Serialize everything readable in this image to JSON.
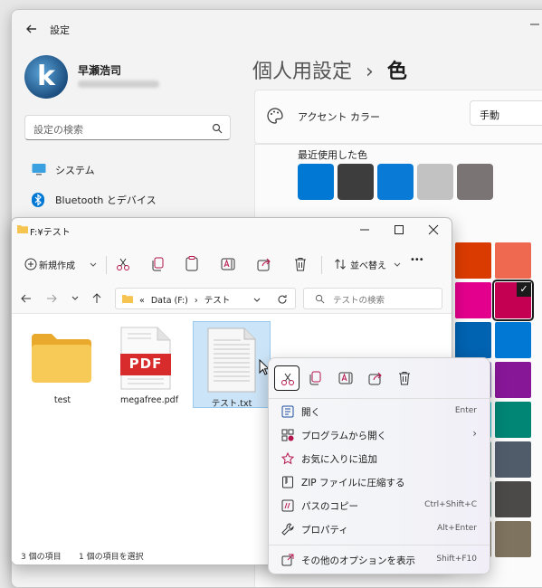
{
  "settings": {
    "app_title": "設定",
    "user_name": "早瀬浩司",
    "avatar_letter": "k",
    "search_placeholder": "設定の検索",
    "nav": [
      {
        "label": "システム",
        "icon": "monitor-icon"
      },
      {
        "label": "Bluetooth とデバイス",
        "icon": "bluetooth-icon"
      }
    ],
    "breadcrumb_parent": "個人用設定",
    "breadcrumb_sep": "›",
    "breadcrumb_current": "色",
    "accent_label": "アクセント カラー",
    "accent_mode": "手動",
    "recent_colors_label": "最近使用した色",
    "recent_colors": [
      "#0078d4",
      "#3d3d3d",
      "#0a7ad7",
      "#c2c2c2",
      "#7a7574"
    ],
    "palette_colors": [
      [
        "#da3b01",
        "#ef6950"
      ],
      [
        "#e3008c",
        "#c30052"
      ],
      [
        "#0063b1",
        "#0078d4"
      ],
      [
        "#8764b8",
        "#881798"
      ],
      [
        "#00b7c3",
        "#018574"
      ],
      [
        "#567c73",
        "#515c6b"
      ],
      [
        "#567c73",
        "#4c4a48"
      ],
      [
        "#7e735f",
        "#7e735f"
      ]
    ],
    "selected_check": "✓"
  },
  "explorer": {
    "title": "F:¥テスト",
    "new_label": "新規作成",
    "sort_label": "並べ替え",
    "more_label": "•••",
    "address_parent": "Data (F:)",
    "address_sep": "›",
    "address_current": "テスト",
    "address_prefix": "«",
    "search_placeholder": "テストの検索",
    "files": [
      {
        "name": "test",
        "type": "folder"
      },
      {
        "name": "megafree.pdf",
        "type": "pdf",
        "badge": "PDF"
      },
      {
        "name": "テスト.txt",
        "type": "txt"
      }
    ],
    "status_count": "3 個の項目",
    "status_selected": "1 個の項目を選択"
  },
  "context_menu": {
    "items": [
      {
        "label": "開く",
        "shortcut": "Enter",
        "icon": "open-icon"
      },
      {
        "label": "プログラムから開く",
        "shortcut": "",
        "icon": "open-with-icon",
        "submenu": true
      },
      {
        "label": "お気に入りに追加",
        "shortcut": "",
        "icon": "star-icon"
      },
      {
        "label": "ZIP ファイルに圧縮する",
        "shortcut": "",
        "icon": "zip-icon"
      },
      {
        "label": "パスのコピー",
        "shortcut": "Ctrl+Shift+C",
        "icon": "copy-path-icon"
      },
      {
        "label": "プロパティ",
        "shortcut": "Alt+Enter",
        "icon": "wrench-icon"
      }
    ],
    "more_options": {
      "label": "その他のオプションを表示",
      "shortcut": "Shift+F10"
    },
    "submenu_arrow": "›"
  },
  "colors": {
    "accent": "#0078d4",
    "selection": "#cce4f7",
    "pdf_red": "#d82c2c",
    "folder_yellow": "#f5c451"
  }
}
